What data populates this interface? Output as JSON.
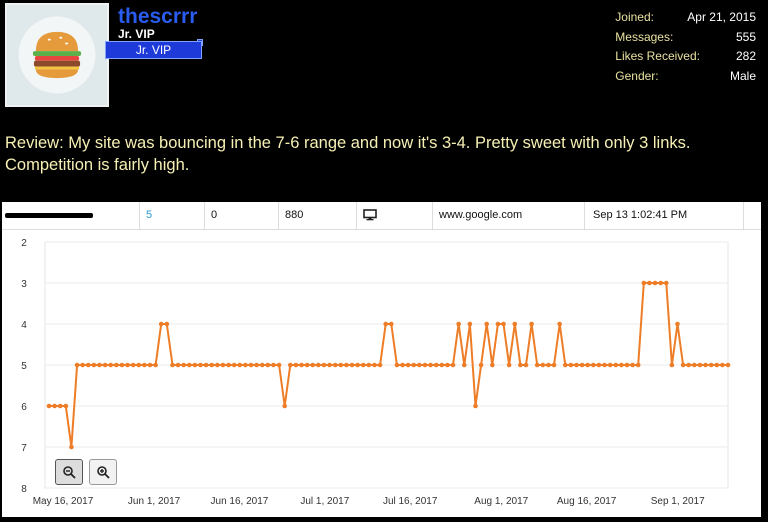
{
  "profile": {
    "username": "thescrrr",
    "user_title": "Jr. VIP",
    "badge_label": "Jr. VIP",
    "avatar_icon": "hamburger-icon"
  },
  "stats": [
    {
      "label": "Joined:",
      "value": "Apr 21, 2015"
    },
    {
      "label": "Messages:",
      "value": "555"
    },
    {
      "label": "Likes Received:",
      "value": "282"
    },
    {
      "label": "Gender:",
      "value": "Male"
    }
  ],
  "review": "Review: My site was bouncing in the 7-6 range and now it's 3-4. Pretty sweet with only 3 links. Competition is fairly high.",
  "rank_row": {
    "rank": "5",
    "change": "0",
    "volume": "880",
    "device_icon": "desktop-icon",
    "engine": "www.google.com",
    "timestamp": "Sep 13 1:02:41 PM"
  },
  "colors": {
    "line": "#ee7d27",
    "username": "#2a5cf0",
    "badge": "#1e3ad8",
    "review_text": "#f6f0b4"
  },
  "controls": {
    "zoom_in_icon": "zoom-in-icon",
    "zoom_out_icon": "zoom-out-icon"
  },
  "chart_data": {
    "type": "line",
    "ylim": [
      8,
      2
    ],
    "y_ticks": [
      "2",
      "3",
      "4",
      "5",
      "6",
      "7",
      "8"
    ],
    "x_ticks": [
      "May 16, 2017",
      "Jun 1, 2017",
      "Jun 16, 2017",
      "Jul 1, 2017",
      "Jul 16, 2017",
      "Aug 1, 2017",
      "Aug 16, 2017",
      "Sep 1, 2017"
    ],
    "x_start": "May 16, 2017",
    "x_end": "Sep 13, 2017",
    "grid": true,
    "series": [
      {
        "values": [
          6,
          6,
          6,
          6,
          7,
          5,
          5,
          5,
          5,
          5,
          5,
          5,
          5,
          5,
          5,
          5,
          5,
          5,
          5,
          5,
          4,
          4,
          5,
          5,
          5,
          5,
          5,
          5,
          5,
          5,
          5,
          5,
          5,
          5,
          5,
          5,
          5,
          5,
          5,
          5,
          5,
          5,
          6,
          5,
          5,
          5,
          5,
          5,
          5,
          5,
          5,
          5,
          5,
          5,
          5,
          5,
          5,
          5,
          5,
          5,
          4,
          4,
          5,
          5,
          5,
          5,
          5,
          5,
          5,
          5,
          5,
          5,
          5,
          4,
          5,
          4,
          6,
          5,
          4,
          5,
          4,
          4,
          5,
          4,
          5,
          5,
          4,
          5,
          5,
          5,
          5,
          4,
          5,
          5,
          5,
          5,
          5,
          5,
          5,
          5,
          5,
          5,
          5,
          5,
          5,
          5,
          3,
          3,
          3,
          3,
          3,
          5,
          4,
          5,
          5,
          5,
          5,
          5,
          5,
          5,
          5,
          5
        ]
      }
    ]
  }
}
